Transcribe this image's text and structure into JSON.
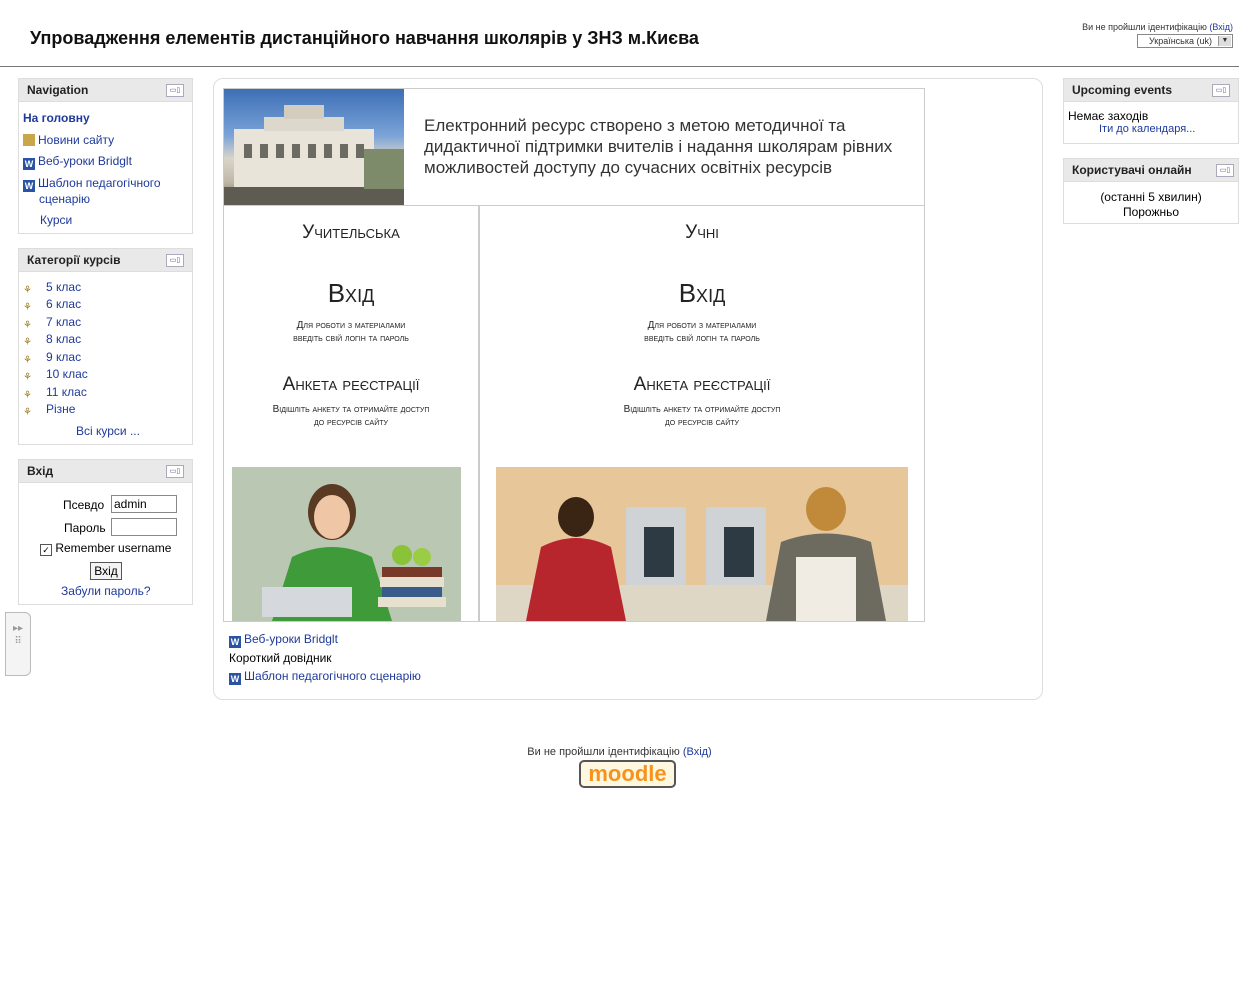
{
  "header": {
    "title": "Упровадження елементів дистанційного навчання школярів у ЗНЗ м.Києва",
    "login_info": "Ви не пройшли ідентифікацію",
    "login_link": "(Вхід)",
    "language": "Українська (uk)"
  },
  "navigation": {
    "title": "Navigation",
    "home": "На головну",
    "items": [
      "Новини сайту",
      "Веб-уроки Bridglt",
      "Шаблон педагогічного",
      "сценарію"
    ],
    "courses": "Курси"
  },
  "categories": {
    "title": "Категорії курсів",
    "items": [
      "5 клас",
      "6 клас",
      "7 клас",
      "8 клас",
      "9 клас",
      "10 клас",
      "11 клас",
      "Різне"
    ],
    "all": "Всі курси ..."
  },
  "login_block": {
    "title": "Вхід",
    "username_label": "Псевдо",
    "username_value": "admin",
    "password_label": "Пароль",
    "remember": "Remember username",
    "button": "Вхід",
    "forgot": "Забули пароль?"
  },
  "events": {
    "title": "Upcoming events",
    "none": "Немає заходів",
    "calendar": "Іти до календаря..."
  },
  "online": {
    "title": "Користувачі онлайн",
    "period": "(останні 5 хвилин)",
    "empty": "Порожньо"
  },
  "main": {
    "banner_text": "Електронний ресурс створено з метою методичної та дидактичної підтримки вчителів  і надання школярам рівних можливостей доступу до сучасних освітніх ресурсів",
    "teacher": {
      "title": "Учительська",
      "login": "Вхід",
      "login_sub1": "Для роботи з матеріалами",
      "login_sub2": "введіть свій логін та пароль",
      "reg": "Анкета реєстрації",
      "reg_sub1": "Відішліть анкету та отримайте доступ",
      "reg_sub2": "до ресурсів сайту"
    },
    "students": {
      "title": "Учні",
      "login": "Вхід",
      "login_sub1": "Для роботи з матеріалами",
      "login_sub2": "введіть свій логін та пароль",
      "reg": "Анкета реєстрації",
      "reg_sub1": "Відішліть анкету та отримайте доступ",
      "reg_sub2": "до ресурсів сайту"
    },
    "links": [
      "Веб-уроки Bridglt",
      "Короткий довідник",
      "Шаблон педагогічного сценарію"
    ]
  },
  "footer": {
    "text": "Ви не пройшли ідентифікацію",
    "link": "(Вхід)",
    "logo": "moodle"
  },
  "colors": {
    "link": "#1e3a9a",
    "moodle_orange": "#f7931d"
  }
}
